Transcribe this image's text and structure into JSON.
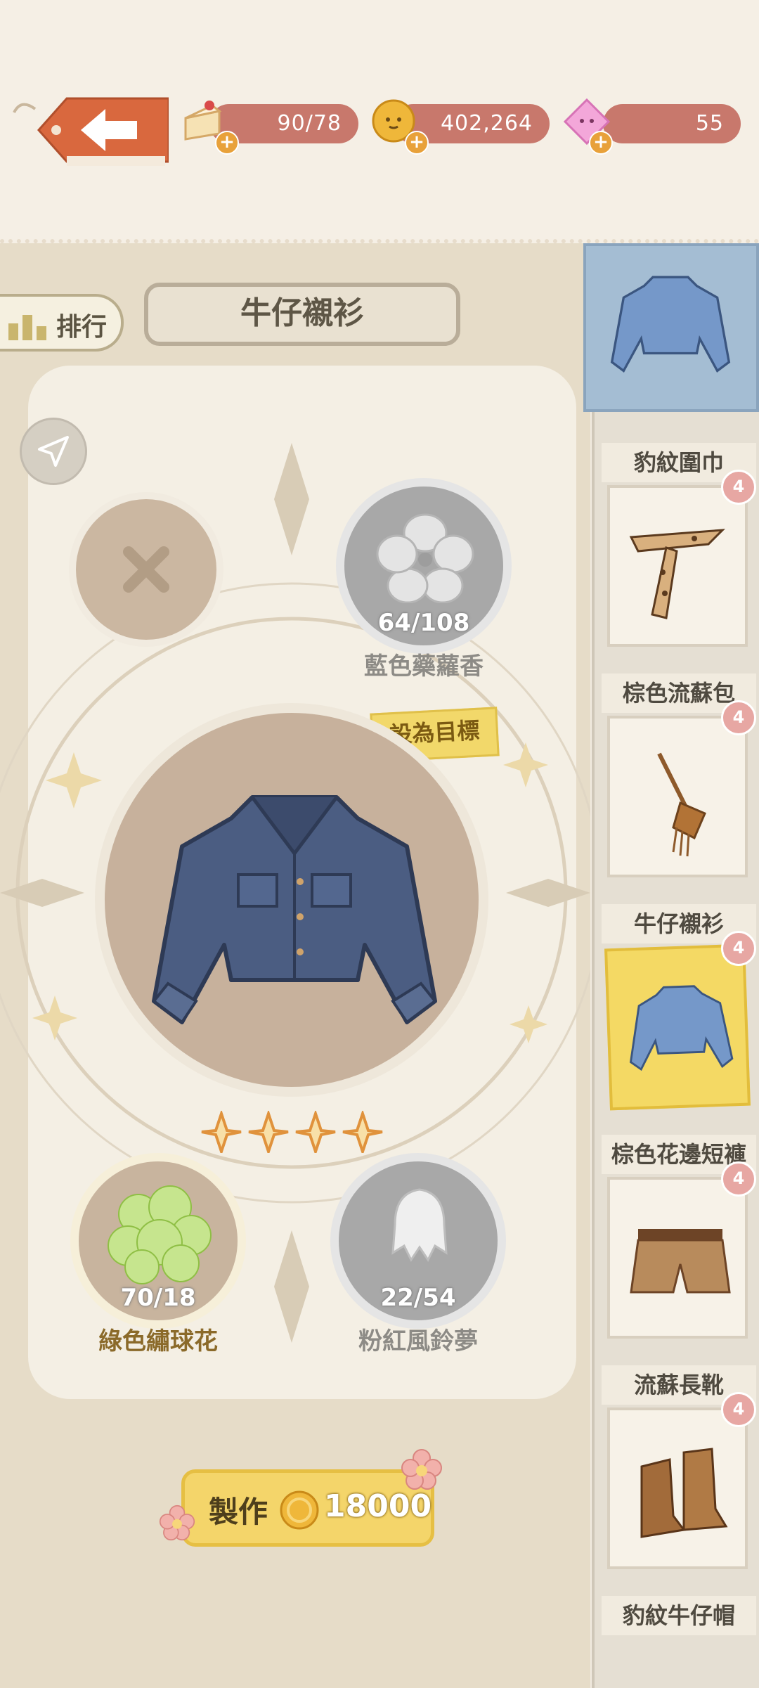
{
  "header": {
    "stamina": "90/78",
    "coins": "402,264",
    "gems": "55"
  },
  "rank_label": "排行",
  "item_title": "牛仔襯衫",
  "target_label": "設為目標",
  "materials": [
    {
      "name": "藍色藥蘿香",
      "count": "64/108"
    },
    {
      "name": "綠色繡球花",
      "count": "70/18"
    },
    {
      "name": "粉紅風鈴夢",
      "count": "22/54"
    }
  ],
  "rarity_stars": 4,
  "craft": {
    "label": "製作",
    "cost": "18000"
  },
  "sidebar": {
    "items": [
      {
        "label": "豹紋圍巾",
        "level": "4"
      },
      {
        "label": "棕色流蘇包",
        "level": "4"
      },
      {
        "label": "牛仔襯衫",
        "level": "4"
      },
      {
        "label": "棕色花邊短褲",
        "level": "4"
      },
      {
        "label": "流蘇長靴",
        "level": "4"
      },
      {
        "label": "豹紋牛仔帽",
        "level": ""
      }
    ]
  },
  "colors": {
    "accent_yellow": "#f4d56a",
    "resource_bar": "#c8786c",
    "selected_top": "#a4bdd3"
  }
}
